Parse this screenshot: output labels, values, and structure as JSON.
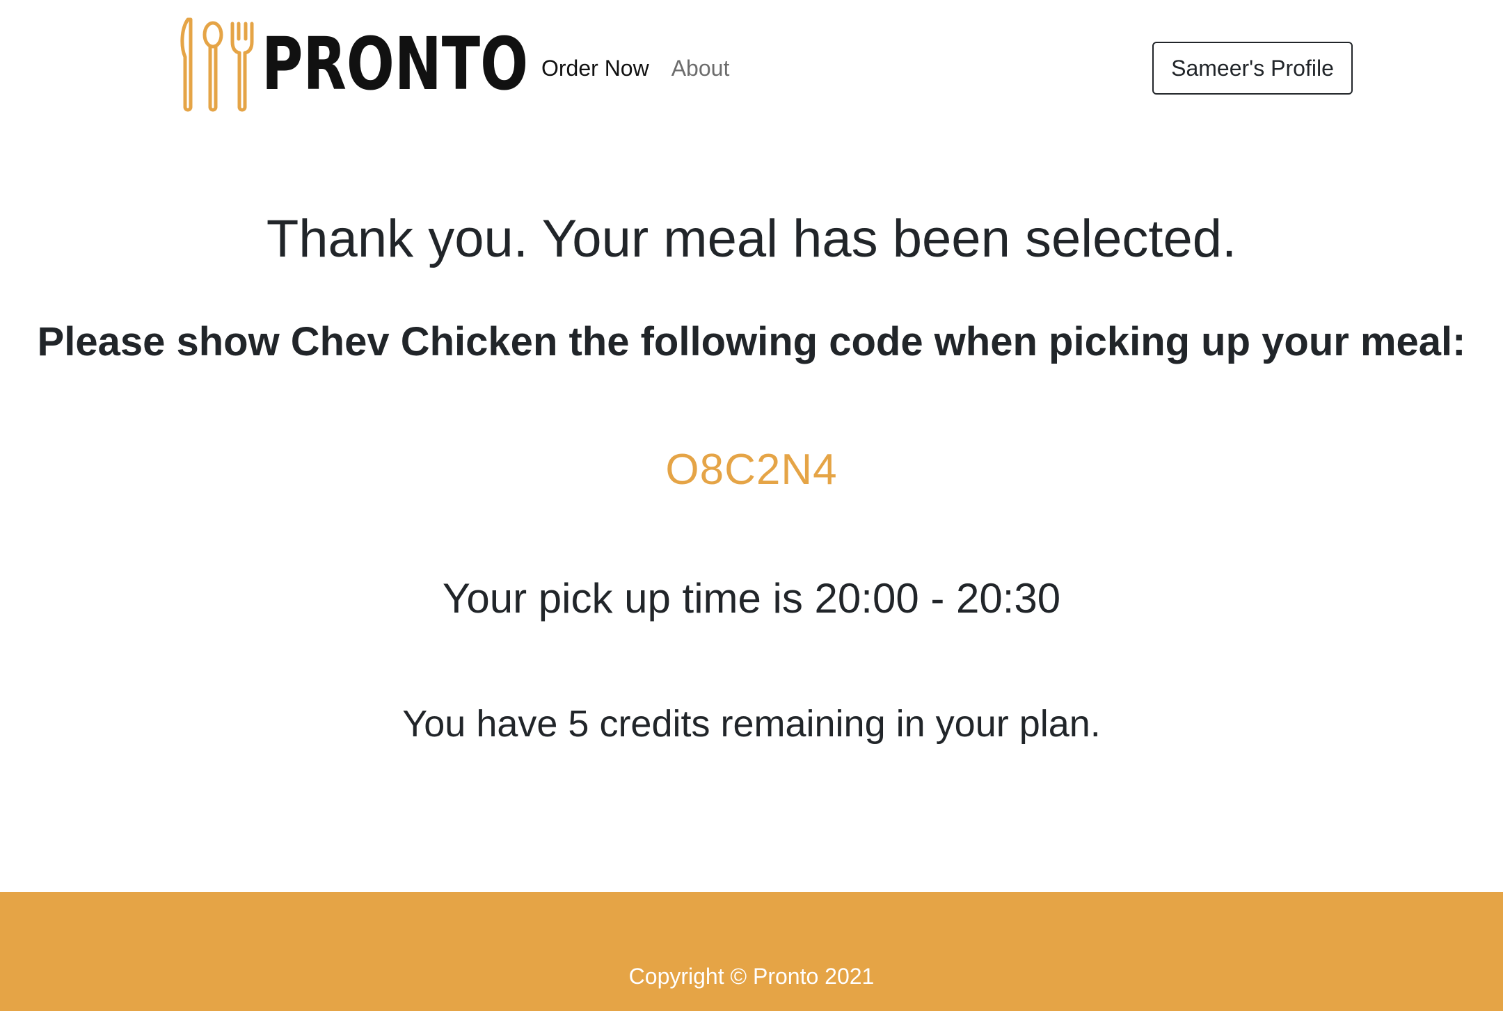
{
  "brand": {
    "name": "PRONTO",
    "icon": "cutlery-icon",
    "accent": "#E5A446"
  },
  "nav": {
    "links": [
      {
        "label": "Order Now"
      },
      {
        "label": "About"
      }
    ],
    "profile_button": "Sameer's Profile"
  },
  "confirmation": {
    "headline": "Thank you. Your meal has been selected.",
    "instruction": "Please show Chev Chicken the following code when picking up your meal:",
    "code": "O8C2N4",
    "pickup": "Your pick up time is 20:00 - 20:30",
    "credits": "You have 5 credits remaining in your plan."
  },
  "footer": {
    "copyright": "Copyright © Pronto 2021"
  },
  "colors": {
    "accent": "#E5A446",
    "text": "#212529",
    "muted": "#6c6c6c"
  }
}
